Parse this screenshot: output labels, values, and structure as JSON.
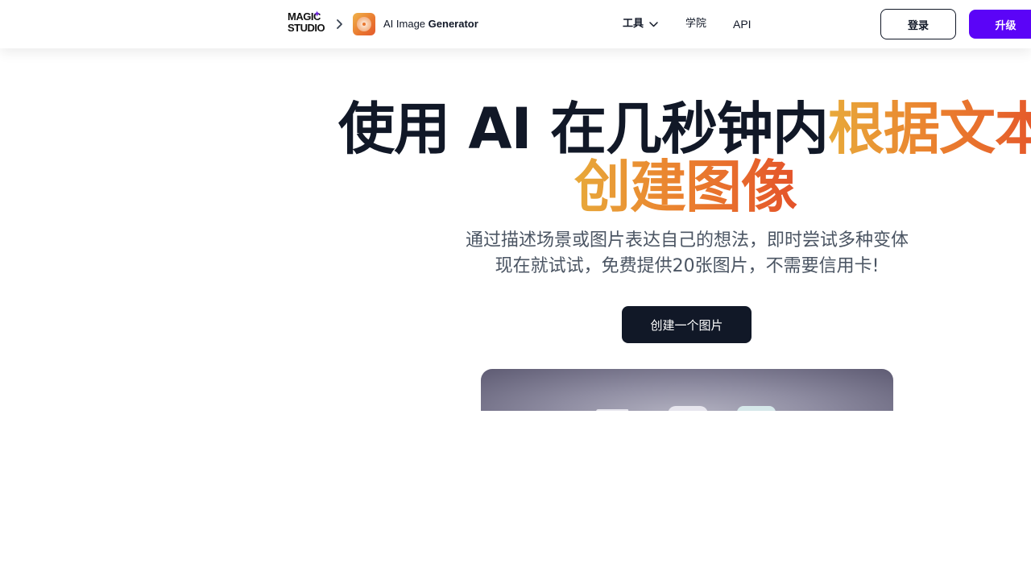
{
  "header": {
    "logo": {
      "line1": "MAGIC",
      "line2": "STUDIO",
      "icon": "sparkle-icon"
    },
    "breadcrumb_icon": "chevron-right-icon",
    "app": {
      "icon": "disc-icon",
      "name_prefix": "AI Image",
      "name_bold": "Generator"
    },
    "nav": {
      "tools_label": "工具",
      "tools_icon": "chevron-down-icon",
      "academy_label": "学院",
      "api_label": "API"
    },
    "login_label": "登录",
    "upgrade_label": "升级"
  },
  "hero": {
    "headline_plain": "使用 AI 在几秒钟内",
    "headline_accent_1": "根据文本",
    "headline_accent_2": "创建图像",
    "subtitle_line1": "通过描述场景或图片表达自己的想法，即时尝试多种变体",
    "subtitle_line2": "现在就试试，免费提供20张图片，不需要信用卡!",
    "cta_label": "创建一个图片"
  },
  "colors": {
    "accent_start": "#e8a93a",
    "accent_end": "#e4532a",
    "upgrade_bg": "#5b04f7",
    "cta_bg": "#111827"
  }
}
